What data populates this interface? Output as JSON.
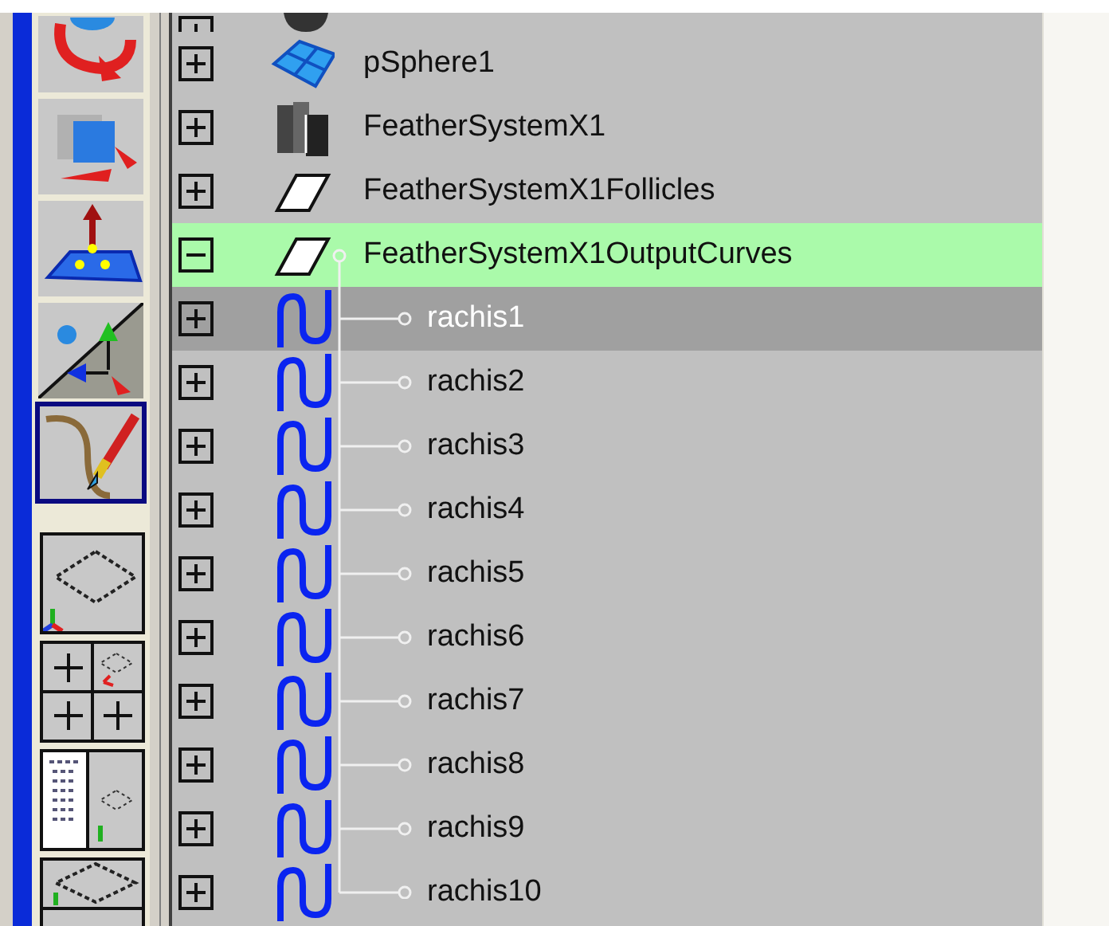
{
  "tools": [
    {
      "kind": "rotate",
      "selected": false
    },
    {
      "kind": "scale",
      "selected": false
    },
    {
      "kind": "soft_mod",
      "selected": false
    },
    {
      "kind": "manipulator",
      "selected": false
    },
    {
      "kind": "paint",
      "selected": true
    }
  ],
  "layouts": [
    {
      "kind": "single"
    },
    {
      "kind": "four"
    },
    {
      "kind": "outliner_persp"
    },
    {
      "kind": "persp_graph"
    }
  ],
  "outliner": {
    "items": [
      {
        "kind": "transform",
        "expanded": false,
        "selected": false,
        "current": false
      },
      {
        "label": "pSphere1",
        "kind": "mesh",
        "expanded": false,
        "selected": false,
        "current": false
      },
      {
        "label": "FeatherSystemX1",
        "kind": "feather_system",
        "expanded": false,
        "selected": false,
        "current": false
      },
      {
        "label": "FeatherSystemX1Follicles",
        "kind": "plane",
        "expanded": false,
        "selected": false,
        "current": false
      },
      {
        "label": "FeatherSystemX1OutputCurves",
        "kind": "plane",
        "expanded": true,
        "selected": true,
        "current": false,
        "children": [
          {
            "label": "rachis1",
            "kind": "curve",
            "expanded": false,
            "selected": false,
            "current": true
          },
          {
            "label": "rachis2",
            "kind": "curve",
            "expanded": false,
            "selected": false,
            "current": false
          },
          {
            "label": "rachis3",
            "kind": "curve",
            "expanded": false,
            "selected": false,
            "current": false
          },
          {
            "label": "rachis4",
            "kind": "curve",
            "expanded": false,
            "selected": false,
            "current": false
          },
          {
            "label": "rachis5",
            "kind": "curve",
            "expanded": false,
            "selected": false,
            "current": false
          },
          {
            "label": "rachis6",
            "kind": "curve",
            "expanded": false,
            "selected": false,
            "current": false
          },
          {
            "label": "rachis7",
            "kind": "curve",
            "expanded": false,
            "selected": false,
            "current": false
          },
          {
            "label": "rachis8",
            "kind": "curve",
            "expanded": false,
            "selected": false,
            "current": false
          },
          {
            "label": "rachis9",
            "kind": "curve",
            "expanded": false,
            "selected": false,
            "current": false
          },
          {
            "label": "rachis10",
            "kind": "curve",
            "expanded": false,
            "selected": false,
            "current": false
          }
        ]
      }
    ]
  }
}
